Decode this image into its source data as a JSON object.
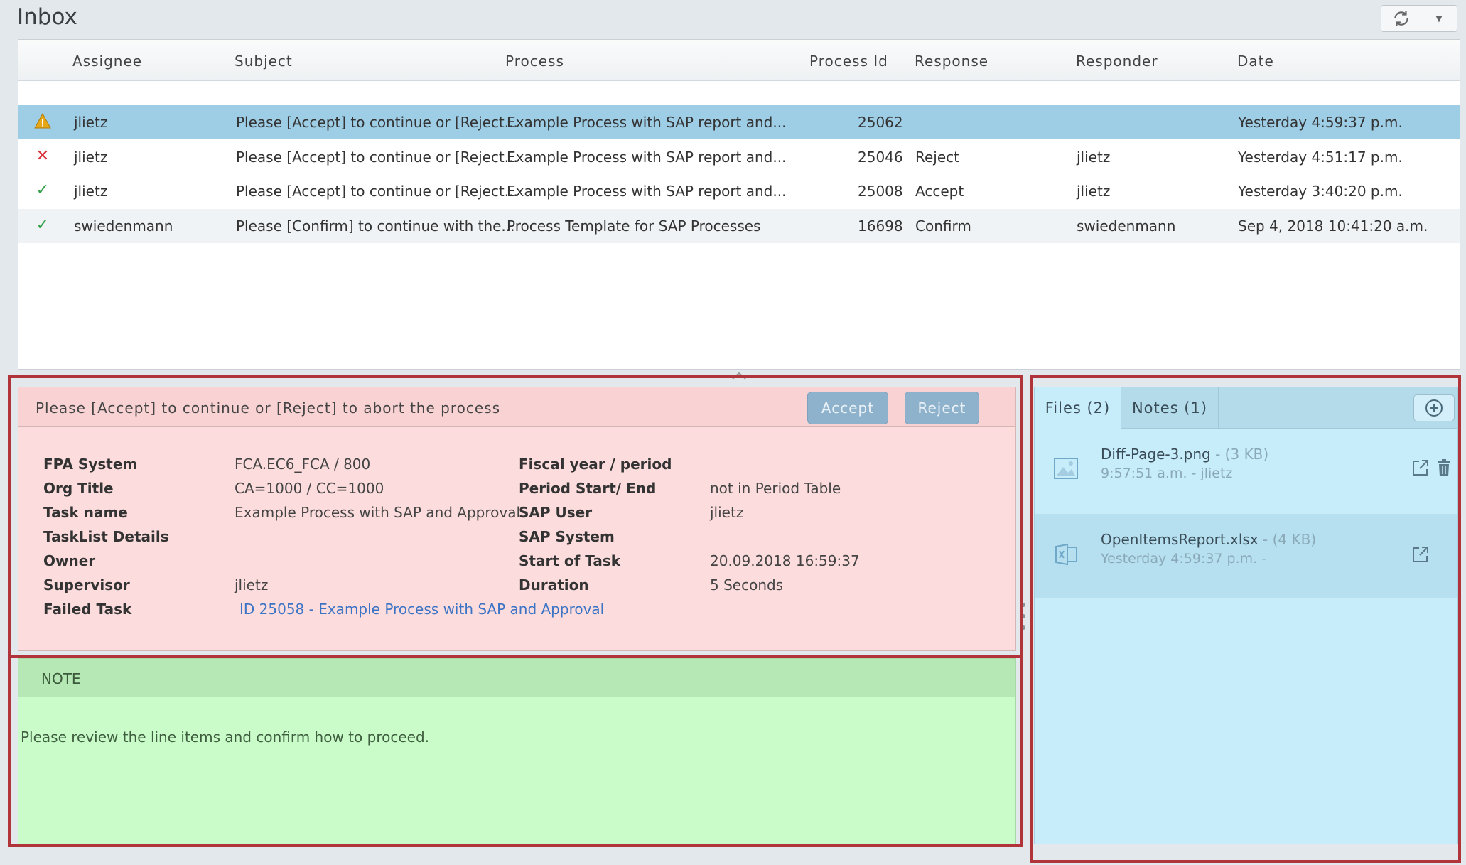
{
  "window": {
    "title": "Inbox"
  },
  "grid": {
    "headers": [
      "Assignee",
      "Subject",
      "Process",
      "Process Id",
      "Response",
      "Responder",
      "Date"
    ],
    "rows": [
      {
        "status": "warning",
        "assignee": "jlietz",
        "subject": "Please [Accept] to continue or [Reject...",
        "process": "Example Process with SAP report and...",
        "process_id": "25062",
        "response": "",
        "responder": "",
        "date": "Yesterday 4:59:37 p.m."
      },
      {
        "status": "rejected",
        "assignee": "jlietz",
        "subject": "Please [Accept] to continue or [Reject...",
        "process": "Example Process with SAP report and...",
        "process_id": "25046",
        "response": "Reject",
        "responder": "jlietz",
        "date": "Yesterday 4:51:17 p.m."
      },
      {
        "status": "accepted",
        "assignee": "jlietz",
        "subject": "Please [Accept] to continue or [Reject...",
        "process": "Example Process with SAP report and...",
        "process_id": "25008",
        "response": "Accept",
        "responder": "jlietz",
        "date": "Yesterday 3:40:20 p.m."
      },
      {
        "status": "accepted",
        "assignee": "swiedenmann",
        "subject": "Please [Confirm] to continue with the...",
        "process": "Process Template for SAP Processes",
        "process_id": "16698",
        "response": "Confirm",
        "responder": "swiedenmann",
        "date": "Sep 4, 2018 10:41:20 a.m."
      }
    ]
  },
  "detail": {
    "title": "Please [Accept] to continue or [Reject] to abort the process",
    "accept_label": "Accept",
    "reject_label": "Reject",
    "left_fields": [
      {
        "label": "FPA System",
        "value": "FCA.EC6_FCA / 800"
      },
      {
        "label": "Org Title",
        "value": "CA=1000 / CC=1000"
      },
      {
        "label": "Task name",
        "value": "Example Process with SAP and Approval"
      },
      {
        "label": "TaskList Details",
        "value": ""
      },
      {
        "label": "Owner",
        "value": "",
        "hidden": true
      },
      {
        "label": "Supervisor",
        "value": "jlietz"
      },
      {
        "label": "Failed Task",
        "value": "ID 25058 - Example Process with SAP and Approval"
      }
    ],
    "right_fields": [
      {
        "label": "Fiscal year / period",
        "value": ""
      },
      {
        "label": "Period Start/ End",
        "value": "not in Period Table"
      },
      {
        "label": "SAP User",
        "value": "jlietz"
      },
      {
        "label": "SAP System",
        "value": ""
      },
      {
        "label": "Start of Task",
        "value": "20.09.2018 16:59:37"
      },
      {
        "label": "Duration",
        "value": "5 Seconds"
      }
    ]
  },
  "note": {
    "title": "NOTE",
    "text": "Please review the line items and confirm how to proceed."
  },
  "side": {
    "tab_files": "Files (2)",
    "tab_notes": "Notes (1)",
    "files": [
      {
        "name": "Diff-Page-3.png",
        "size": "- (3 KB)",
        "meta": "9:57:51 a.m. - jlietz",
        "icon": "image-file-icon"
      },
      {
        "name": "OpenItemsReport.xlsx",
        "size": "- (4 KB)",
        "meta": "Yesterday 4:59:37 p.m. -",
        "icon": "spreadsheet-file-icon"
      }
    ]
  },
  "colors": {
    "selected_row": "#9ecde6",
    "detail_bg": "#fcdcdc",
    "note_bg": "#c9fcc9",
    "side_bg": "#c7ecfa",
    "highlight_border": "#b0343a",
    "error": "#d9323b",
    "success": "#2e9e46",
    "warning": "#e6a817"
  }
}
